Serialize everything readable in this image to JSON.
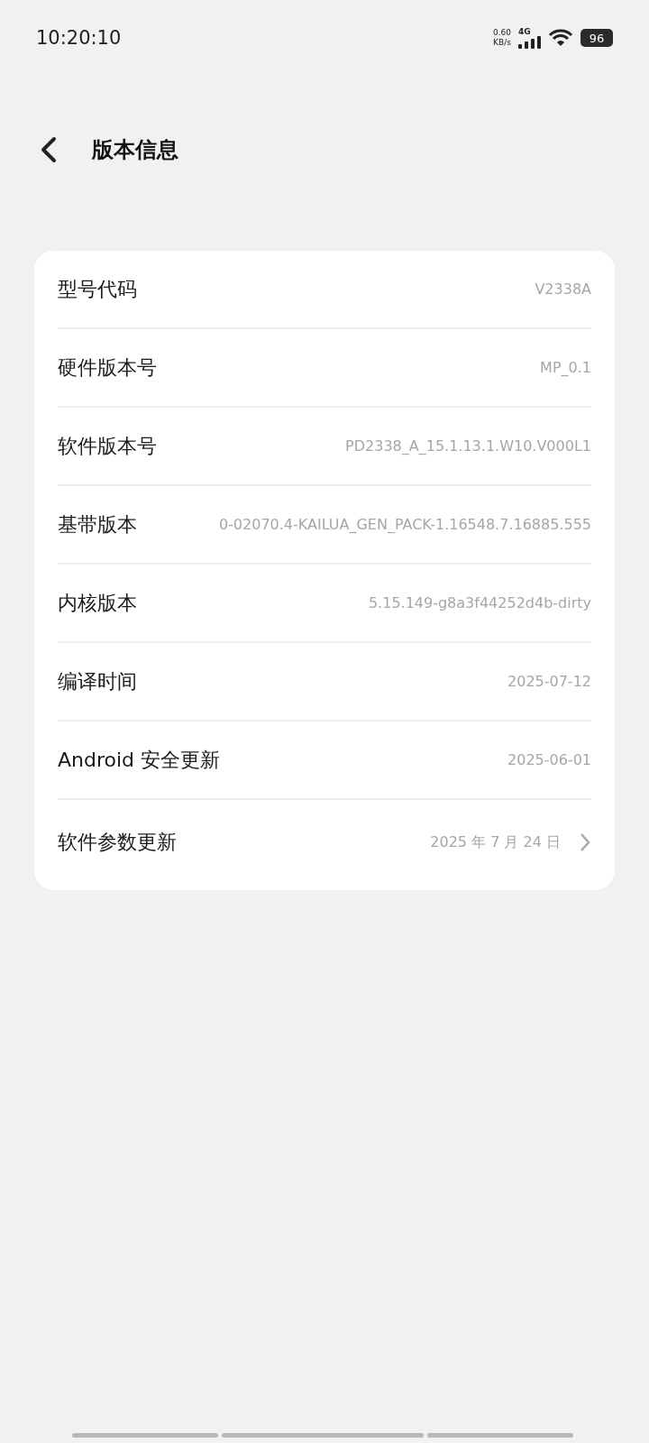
{
  "status_bar": {
    "time": "10:20:10",
    "speed_value": "0.60",
    "speed_unit": "KB/s",
    "network": "4G",
    "battery": "96"
  },
  "header": {
    "title": "版本信息"
  },
  "rows": [
    {
      "kind": "info",
      "label": "型号代码",
      "value": "V2338A"
    },
    {
      "kind": "info",
      "label": "硬件版本号",
      "value": "MP_0.1"
    },
    {
      "kind": "info",
      "label": "软件版本号",
      "value": "PD2338_A_15.1.13.1.W10.V000L1"
    },
    {
      "kind": "info",
      "label": "基带版本",
      "value": "0-02070.4-KAILUA_GEN_PACK-1.16548.7.16885.555"
    },
    {
      "kind": "info",
      "label": "内核版本",
      "value": "5.15.149-g8a3f44252d4b-dirty"
    },
    {
      "kind": "info",
      "label": "编译时间",
      "value": "2025-07-12"
    },
    {
      "kind": "info",
      "label": "Android 安全更新",
      "value": "2025-06-01"
    },
    {
      "kind": "link",
      "label": "软件参数更新",
      "value": "2025 年 7 月 24 日"
    }
  ]
}
